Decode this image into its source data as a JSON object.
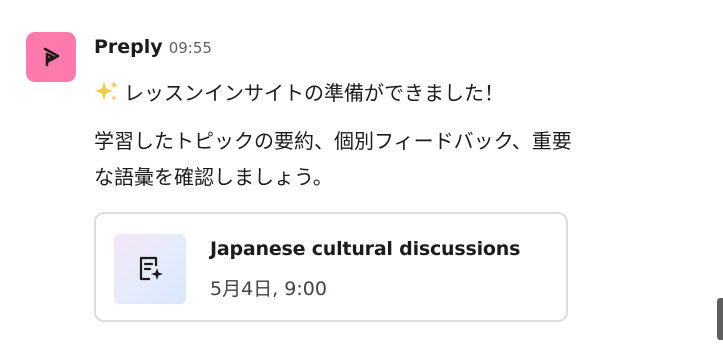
{
  "message": {
    "sender": "Preply",
    "time": "09:55",
    "avatar_icon": "preply-logo-icon",
    "avatar_color": "#ff7aac",
    "headline_emoji": "sparkles-icon",
    "headline": "レッスンインサイトの準備ができました！",
    "body_lines": [
      "学習したトピックの要約、個別フィードバック、重要",
      "な語彙を確認しましょう。"
    ]
  },
  "card": {
    "icon": "ai-notes-icon",
    "title": "Japanese cultural discussions",
    "subtitle": "5月4日, 9:00"
  }
}
